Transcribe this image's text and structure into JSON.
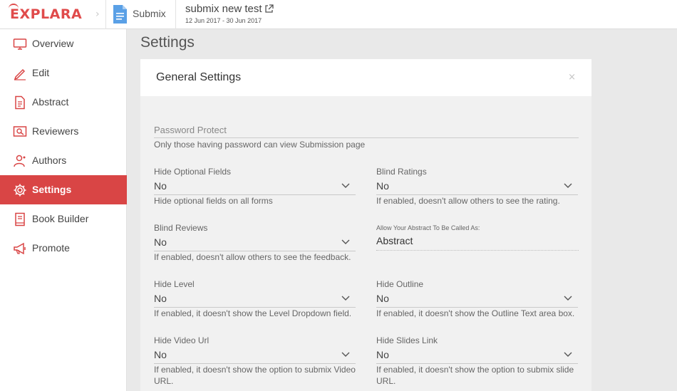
{
  "header": {
    "logo": "EXPLARA",
    "breadcrumb_app": "Submix",
    "event_title": "submix new test",
    "event_dates": "12 Jun 2017 - 30 Jun 2017"
  },
  "sidebar": {
    "items": [
      {
        "label": "Overview",
        "icon": "monitor-icon"
      },
      {
        "label": "Edit",
        "icon": "pencil-icon"
      },
      {
        "label": "Abstract",
        "icon": "document-icon"
      },
      {
        "label": "Reviewers",
        "icon": "reviewer-icon"
      },
      {
        "label": "Authors",
        "icon": "author-icon"
      },
      {
        "label": "Settings",
        "icon": "gear-icon",
        "active": true
      },
      {
        "label": "Book Builder",
        "icon": "book-icon"
      },
      {
        "label": "Promote",
        "icon": "megaphone-icon"
      }
    ],
    "active_color": "#d94545",
    "icon_color": "#d94545"
  },
  "page": {
    "title": "Settings"
  },
  "general": {
    "title": "General Settings",
    "close": "×",
    "password": {
      "placeholder": "Password Protect",
      "help": "Only those having password can view Submission page"
    },
    "hide_optional": {
      "label": "Hide Optional Fields",
      "value": "No",
      "help": "Hide optional fields on all forms"
    },
    "blind_ratings": {
      "label": "Blind Ratings",
      "value": "No",
      "help": "If enabled, doesn't allow others to see the rating."
    },
    "blind_reviews": {
      "label": "Blind Reviews",
      "value": "No",
      "help": "If enabled, doesn't allow others to see the feedback."
    },
    "abstract_name": {
      "label": "Allow Your Abstract To Be Called As:",
      "value": "Abstract"
    },
    "hide_level": {
      "label": "Hide Level",
      "value": "No",
      "help": "If enabled, it doesn't show the Level Dropdown field."
    },
    "hide_outline": {
      "label": "Hide Outline",
      "value": "No",
      "help": "If enabled, it doesn't show the Outline Text area box."
    },
    "hide_video": {
      "label": "Hide Video Url",
      "value": "No",
      "help": "If enabled, it doesn't show the option to submix Video URL."
    },
    "hide_slides": {
      "label": "Hide Slides Link",
      "value": "No",
      "help": "If enabled, it doesn't show the option to submix slide URL."
    }
  }
}
